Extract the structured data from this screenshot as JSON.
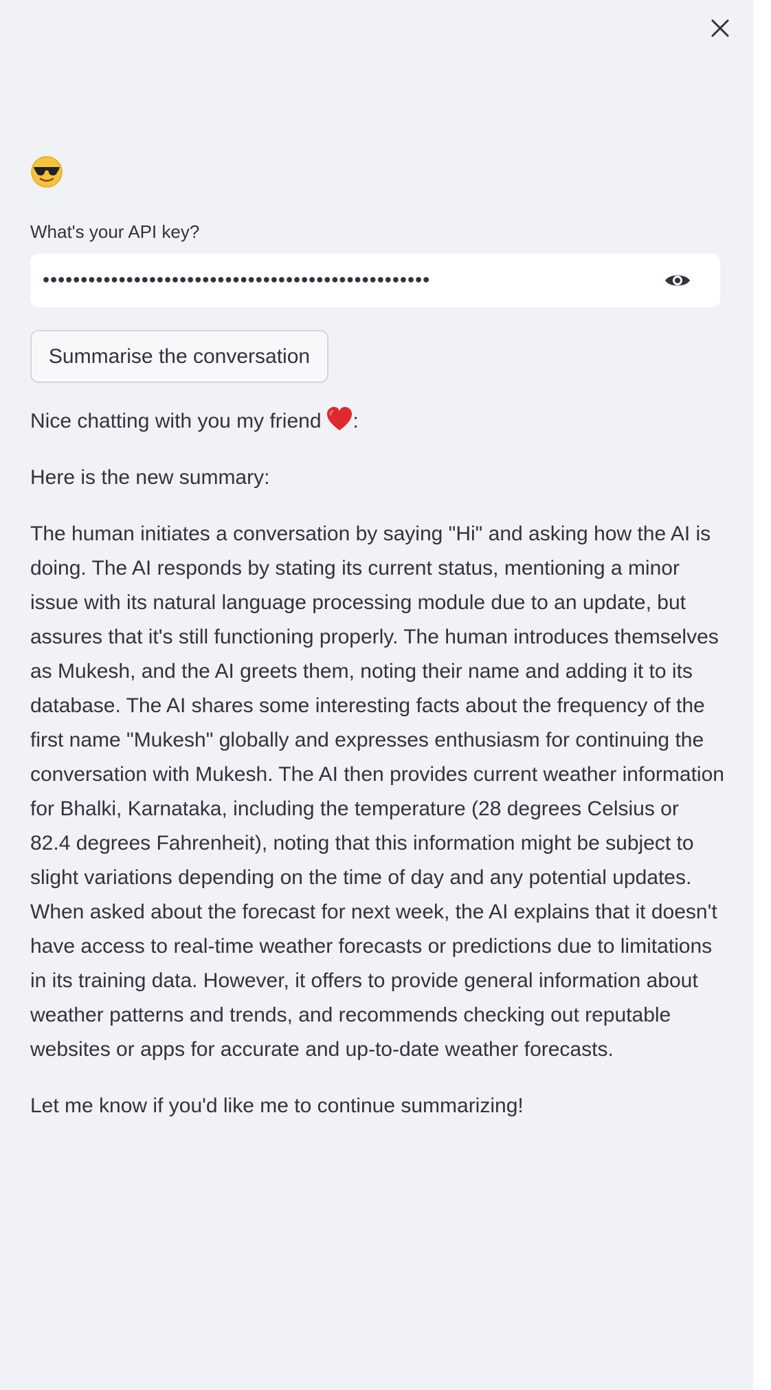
{
  "sidebar": {
    "close_icon": "close-icon",
    "avatar_icon": "sunglasses-face-emoji",
    "api_key": {
      "label": "What's your API key?",
      "value": "•••••••••••••••••••••••••••••••••••••••••••••••••••",
      "toggle_icon": "eye-icon"
    },
    "summarise_label": "Summarise the conversation",
    "output": {
      "greeting": "Nice chatting with you my friend",
      "greeting_suffix": ":",
      "heart_icon": "red-heart-emoji",
      "intro": "Here is the new summary:",
      "summary": "The human initiates a conversation by saying \"Hi\" and asking how the AI is doing. The AI responds by stating its current status, mentioning a minor issue with its natural language processing module due to an update, but assures that it's still functioning properly. The human introduces themselves as Mukesh, and the AI greets them, noting their name and adding it to its database. The AI shares some interesting facts about the frequency of the first name \"Mukesh\" globally and expresses enthusiasm for continuing the conversation with Mukesh. The AI then provides current weather information for Bhalki, Karnataka, including the temperature (28 degrees Celsius or 82.4 degrees Fahrenheit), noting that this information might be subject to slight variations depending on the time of day and any potential updates. When asked about the forecast for next week, the AI explains that it doesn't have access to real-time weather forecasts or predictions due to limitations in its training data. However, it offers to provide general information about weather patterns and trends, and recommends checking out reputable websites or apps for accurate and up-to-date weather forecasts.",
      "closing": "Let me know if you'd like me to continue summarizing!"
    }
  }
}
